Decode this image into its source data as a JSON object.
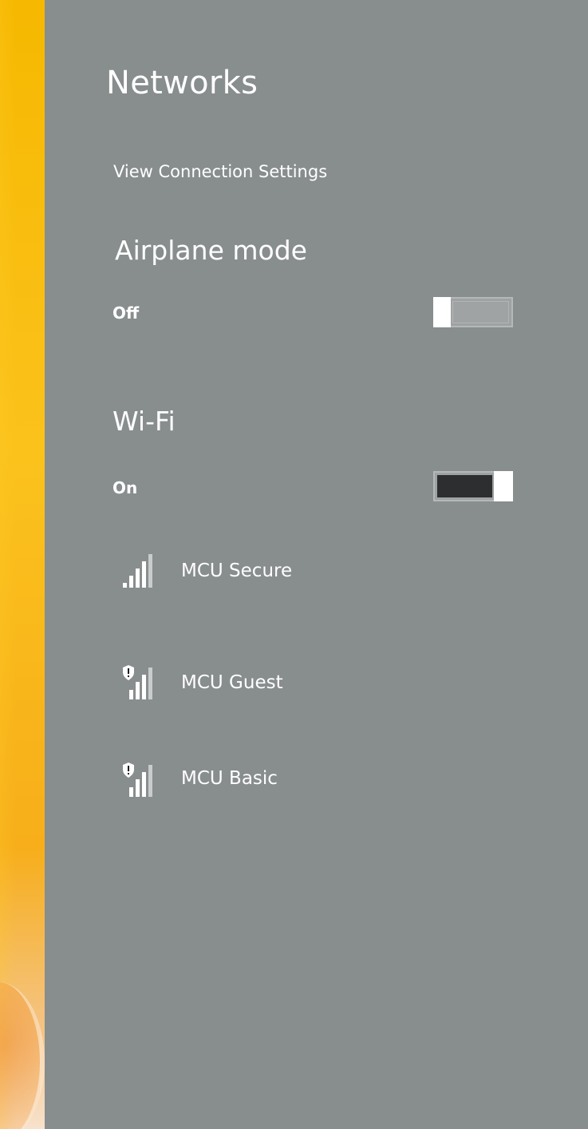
{
  "pane": {
    "title": "Networks",
    "view_settings_link": "View Connection Settings"
  },
  "airplane_mode": {
    "heading": "Airplane mode",
    "state": "Off",
    "enabled": false
  },
  "wifi": {
    "heading": "Wi-Fi",
    "state": "On",
    "enabled": true,
    "networks": [
      {
        "name": "MCU Secure",
        "secured": true,
        "shield_warning": false,
        "icon": "wifi-signal-icon"
      },
      {
        "name": "MCU Guest",
        "secured": false,
        "shield_warning": true,
        "icon": "wifi-signal-shield-icon"
      },
      {
        "name": "MCU Basic",
        "secured": false,
        "shield_warning": true,
        "icon": "wifi-signal-shield-icon"
      }
    ]
  },
  "colors": {
    "pane_background": "#888d8e",
    "text": "#ffffff",
    "toggle_on_track": "#2d2e30",
    "desktop_accent": "#f6b800"
  }
}
